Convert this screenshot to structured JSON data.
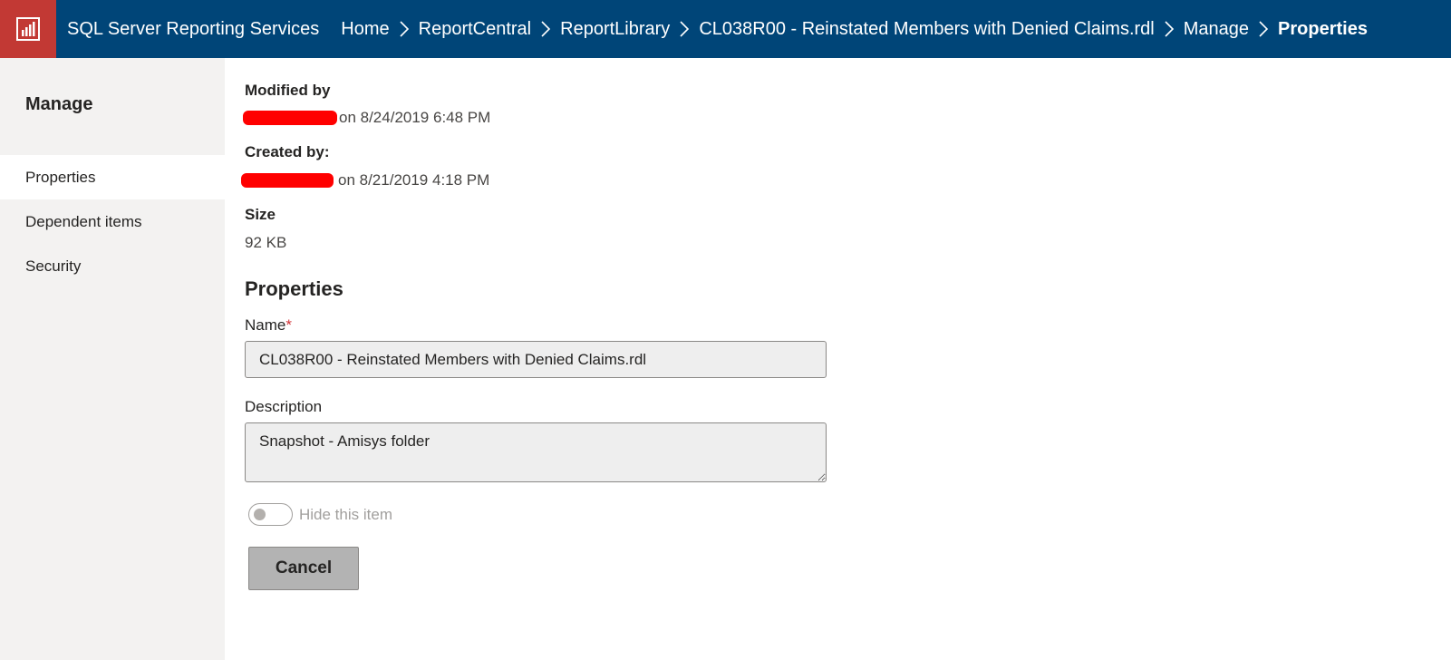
{
  "app": {
    "title": "SQL Server Reporting Services",
    "logo_icon": "report-chart-icon"
  },
  "breadcrumb": [
    {
      "label": "Home"
    },
    {
      "label": "ReportCentral"
    },
    {
      "label": "ReportLibrary"
    },
    {
      "label": "CL038R00 - Reinstated Members with Denied Claims.rdl"
    },
    {
      "label": "Manage"
    },
    {
      "label": "Properties"
    }
  ],
  "sidebar": {
    "title": "Manage",
    "items": [
      {
        "label": "Properties",
        "active": true
      },
      {
        "label": "Dependent items",
        "active": false
      },
      {
        "label": "Security",
        "active": false
      }
    ]
  },
  "info": {
    "modified_label": "Modified by",
    "modified_value": "on 8/24/2019 6:48 PM",
    "created_label": "Created by:",
    "created_value": "on 8/21/2019 4:18 PM",
    "size_label": "Size",
    "size_value": "92 KB"
  },
  "properties": {
    "heading": "Properties",
    "name_label": "Name",
    "name_required_marker": "*",
    "name_value": "CL038R00 - Reinstated Members with Denied Claims.rdl",
    "description_label": "Description",
    "description_value": "Snapshot - Amisys folder",
    "hide_label": "Hide this item",
    "hide_checked": false
  },
  "actions": {
    "cancel_label": "Cancel"
  },
  "colors": {
    "header_bg": "#004578",
    "logo_bg": "#c23934",
    "sidebar_bg": "#f3f2f1",
    "required": "#d13438",
    "redaction": "#ff0000"
  }
}
